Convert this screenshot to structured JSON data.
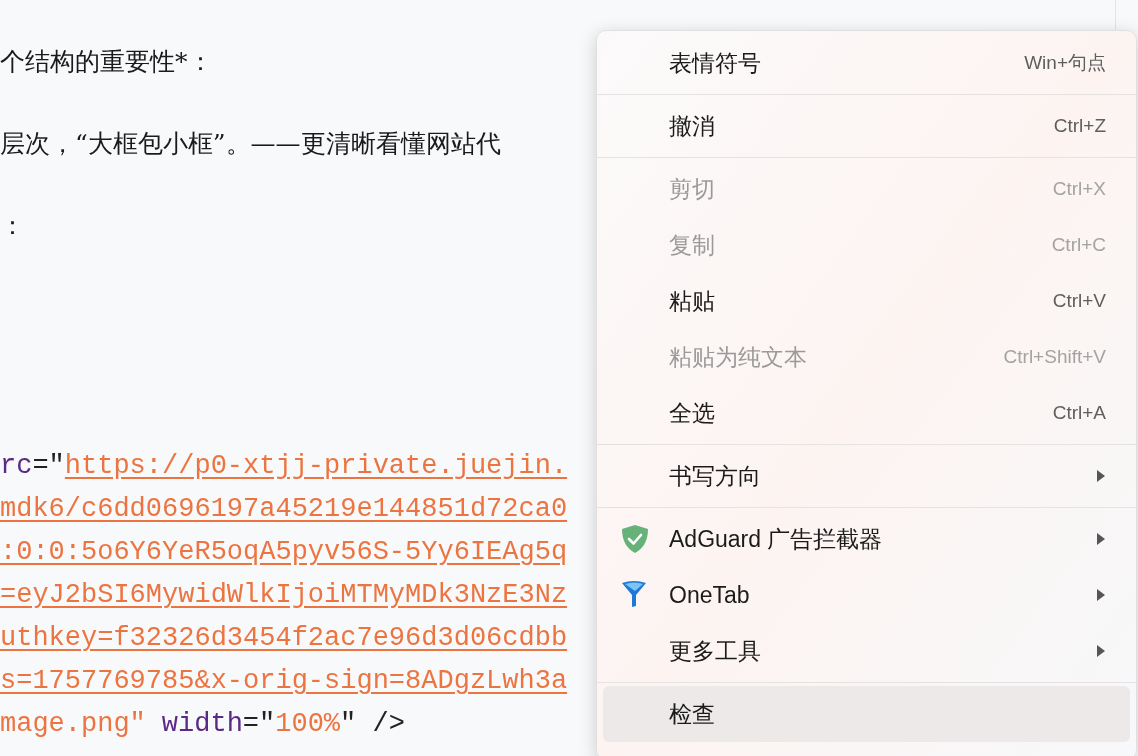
{
  "document": {
    "paragraphs": [
      "个结构的重要性*：",
      "层次，“大框包小框”。——更清晰看懂网站代",
      "："
    ],
    "code_lines": [
      [
        {
          "kind": "attr",
          "text": "rc"
        },
        {
          "kind": "punct",
          "text": "=\""
        },
        {
          "kind": "url",
          "text": "https://p0-xtjj-private.juejin."
        }
      ],
      [
        {
          "kind": "url",
          "text": "mdk6/c6dd0696197a45219e144851d72ca0"
        }
      ],
      [
        {
          "kind": "url",
          "text": ":0:0:5o6Y6YeR5oqA5pyv56S-5Yy6IEAg5q"
        }
      ],
      [
        {
          "kind": "url",
          "text": "=eyJ2bSI6MywidWlkIjoiMTMyMDk3NzE3Nz"
        }
      ],
      [
        {
          "kind": "url",
          "text": "uthkey=f32326d3454f2ac7e96d3d06cdbb"
        }
      ],
      [
        {
          "kind": "url",
          "text": "s=1757769785&x-orig-sign=8ADgzLwh3a"
        }
      ],
      [
        {
          "kind": "string",
          "text": "mage.png\""
        },
        {
          "kind": "attr",
          "text": "width"
        },
        {
          "kind": "punct",
          "text": "=\""
        },
        {
          "kind": "string",
          "text": "100%"
        },
        {
          "kind": "punct",
          "text": "\" />"
        }
      ]
    ]
  },
  "context_menu": {
    "groups": [
      [
        {
          "label": "表情符号",
          "shortcut": "Win+句点",
          "disabled": false,
          "submenu": false,
          "highlighted": false
        }
      ],
      [
        {
          "label": "撤消",
          "shortcut": "Ctrl+Z",
          "disabled": false,
          "submenu": false,
          "highlighted": false
        }
      ],
      [
        {
          "label": "剪切",
          "shortcut": "Ctrl+X",
          "disabled": true,
          "submenu": false,
          "highlighted": false
        },
        {
          "label": "复制",
          "shortcut": "Ctrl+C",
          "disabled": true,
          "submenu": false,
          "highlighted": false
        },
        {
          "label": "粘贴",
          "shortcut": "Ctrl+V",
          "disabled": false,
          "submenu": false,
          "highlighted": false
        },
        {
          "label": "粘贴为纯文本",
          "shortcut": "Ctrl+Shift+V",
          "disabled": true,
          "submenu": false,
          "highlighted": false
        },
        {
          "label": "全选",
          "shortcut": "Ctrl+A",
          "disabled": false,
          "submenu": false,
          "highlighted": false
        }
      ],
      [
        {
          "label": "书写方向",
          "disabled": false,
          "submenu": true,
          "highlighted": false
        }
      ],
      [
        {
          "label": "AdGuard 广告拦截器",
          "kind": "extension",
          "disabled": false,
          "submenu": true,
          "highlighted": false
        },
        {
          "label": "OneTab",
          "kind": "extension",
          "disabled": false,
          "submenu": true,
          "highlighted": false
        },
        {
          "label": "更多工具",
          "disabled": false,
          "submenu": true,
          "highlighted": false
        }
      ],
      [
        {
          "label": "检查",
          "disabled": false,
          "submenu": false,
          "highlighted": true
        }
      ]
    ]
  }
}
